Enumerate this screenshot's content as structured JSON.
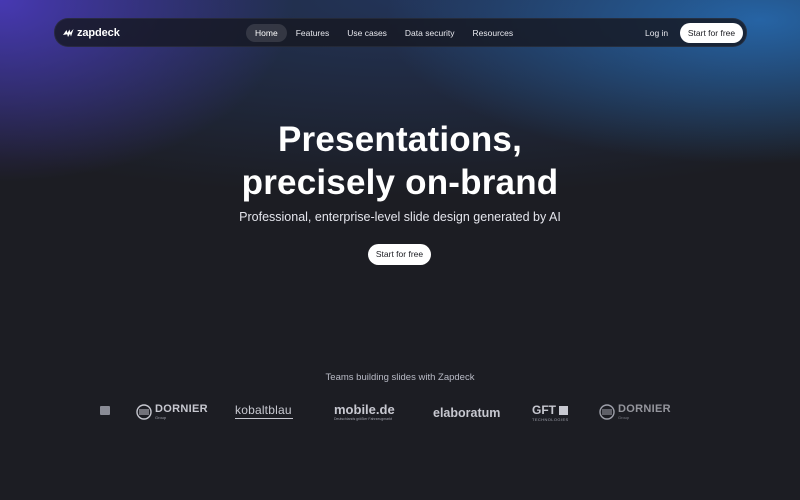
{
  "brand": {
    "name": "zapdeck",
    "icon": "lightning-logo-icon"
  },
  "nav": {
    "links": [
      "Home",
      "Features",
      "Use cases",
      "Data security",
      "Resources"
    ],
    "active": "Home",
    "login": "Log in",
    "cta": "Start for free"
  },
  "hero": {
    "title_line1": "Presentations,",
    "title_line2": "precisely on-brand",
    "subtitle": "Professional, enterprise-level slide design generated by AI",
    "cta": "Start for free"
  },
  "teams": {
    "heading": "Teams building slides with Zapdeck",
    "logos": [
      {
        "name": "DORNIER",
        "sub": "Group"
      },
      {
        "name": "kobaltblau"
      },
      {
        "name": "mobile.de",
        "sub": "Deutschlands größter Fahrzeugmarkt"
      },
      {
        "name": "elaboratum"
      },
      {
        "name": "GFT",
        "sub": "TECHNOLOGIES"
      },
      {
        "name": "DORNIER",
        "sub": "Group"
      }
    ]
  },
  "colors": {
    "background": "#1c1d23",
    "glow_left": "#4e3cc8",
    "glow_right": "#2878c8",
    "button": "#ffffff"
  }
}
